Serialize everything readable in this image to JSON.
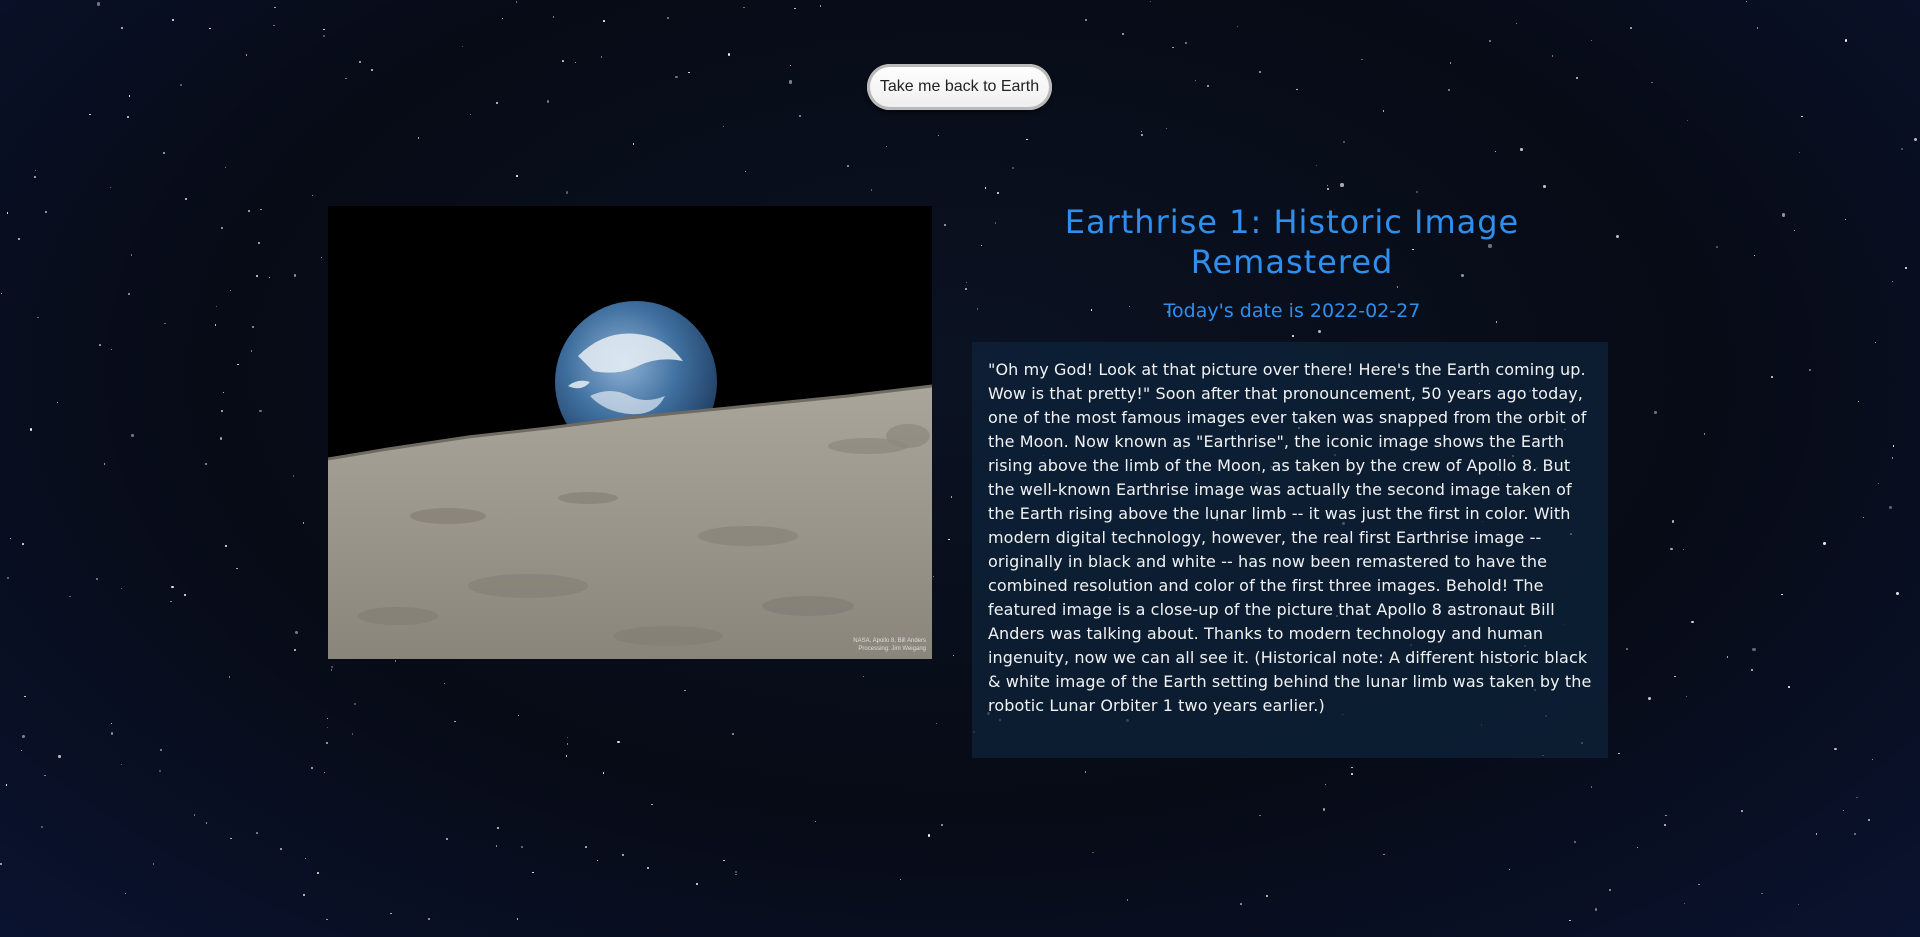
{
  "nav": {
    "back_button_label": "Take me back to Earth"
  },
  "apod": {
    "title": "Earthrise 1: Historic Image Remastered",
    "date_line": "Today's date is 2022-02-27",
    "image_credit_line1": "NASA, Apollo 8, Bill Anders",
    "image_credit_line2": "Processing: Jim Weigang",
    "explanation": "\"Oh my God! Look at that picture over there! Here's the Earth coming up. Wow is that pretty!\" Soon after that pronouncement, 50 years ago today, one of the most famous images ever taken was snapped from the orbit of the Moon. Now known as \"Earthrise\", the iconic image shows the Earth rising above the limb of the Moon, as taken by the crew of Apollo 8. But the well-known Earthrise image was actually the second image taken of the Earth rising above the lunar limb -- it was just the first in color. With modern digital technology, however, the real first Earthrise image -- originally in black and white -- has now been remastered to have the combined resolution and color of the first three images. Behold! The featured image is a close-up of the picture that Apollo 8 astronaut Bill Anders was talking about. Thanks to modern technology and human ingenuity, now we can all see it. (Historical note: A different historic black & white image of the Earth setting behind the lunar limb was taken by the robotic Lunar Orbiter 1 two years earlier.)"
  },
  "colors": {
    "accent": "#2f8fee",
    "background": "#070b16",
    "panel": "#0e243c",
    "text": "#f2f2f2"
  }
}
